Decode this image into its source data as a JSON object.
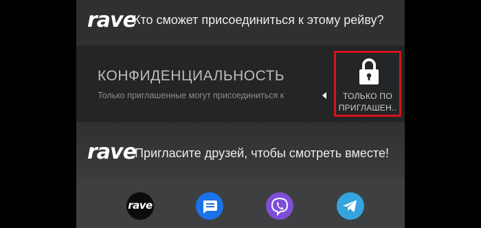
{
  "header": {
    "logo": "rave",
    "question": "Кто сможет присоединиться к этому рейву?"
  },
  "privacy": {
    "title": "КОНФИДЕНЦИАЛЬНОСТЬ",
    "description": "Только приглашенные могут присоединиться к",
    "option": {
      "icon": "lock-icon",
      "line1": "ТОЛЬКО ПО",
      "line2": "ПРИГЛАШЕН..",
      "highlight_color": "#d4141c"
    }
  },
  "invite": {
    "logo": "rave",
    "text": "Пригласите друзей, чтобы смотреть вместе!"
  },
  "share": {
    "apps": [
      {
        "icon": "rave-app-icon",
        "label": "rave",
        "color": "#0b0b0b"
      },
      {
        "icon": "messages-icon",
        "color": "#1a73e8"
      },
      {
        "icon": "viber-icon",
        "color": "#7d4fd6"
      },
      {
        "icon": "telegram-icon",
        "color": "#35a3dc"
      }
    ]
  }
}
